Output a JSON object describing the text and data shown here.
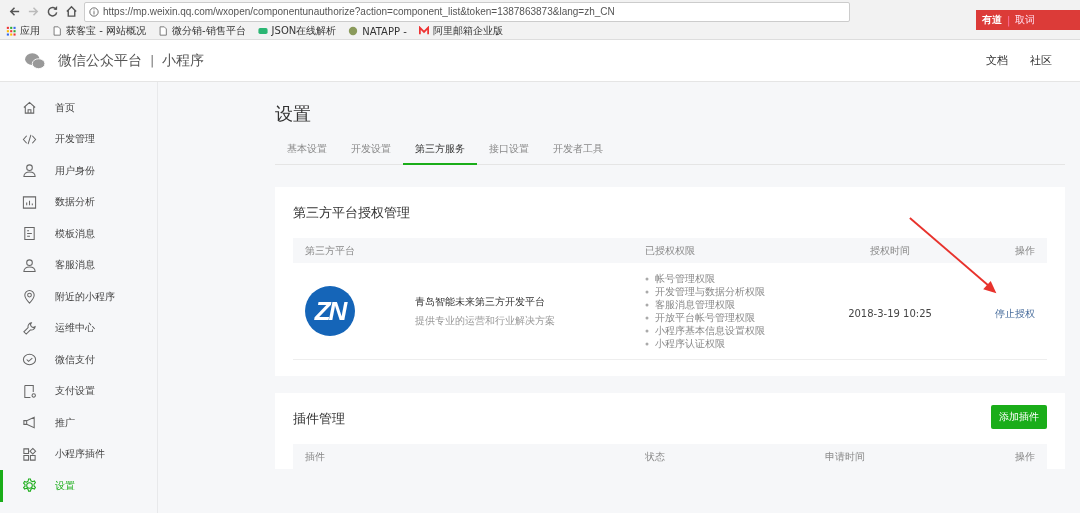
{
  "browser": {
    "url": "https://mp.weixin.qq.com/wxopen/componentunauthorize?action=component_list&token=1387863873&lang=zh_CN",
    "bookmarks": [
      {
        "kind": "apps",
        "label": "应用"
      },
      {
        "kind": "page",
        "label": "获客宝 - 网站概况"
      },
      {
        "kind": "page",
        "label": "微分销-销售平台"
      },
      {
        "kind": "json",
        "label": "JSON在线解析"
      },
      {
        "kind": "natapp",
        "label": "NATAPP -"
      },
      {
        "kind": "mail",
        "label": "阿里邮箱企业版"
      }
    ],
    "extension_popup": {
      "brand": "有道",
      "separator": "|",
      "action": "取词"
    }
  },
  "header": {
    "brand": "微信公众平台",
    "separator": "|",
    "product": "小程序",
    "links": [
      "文档",
      "社区"
    ]
  },
  "sidebar": {
    "items": [
      {
        "kind": "home",
        "label": "首页",
        "selected": false
      },
      {
        "kind": "code",
        "label": "开发管理",
        "selected": false
      },
      {
        "kind": "user",
        "label": "用户身份",
        "selected": false
      },
      {
        "kind": "chart",
        "label": "数据分析",
        "selected": false
      },
      {
        "kind": "doc",
        "label": "模板消息",
        "selected": false
      },
      {
        "kind": "user",
        "label": "客服消息",
        "selected": false
      },
      {
        "kind": "pin",
        "label": "附近的小程序",
        "selected": false
      },
      {
        "kind": "wrench",
        "label": "运维中心",
        "selected": false
      },
      {
        "kind": "pay",
        "label": "微信支付",
        "selected": false
      },
      {
        "kind": "payset",
        "label": "支付设置",
        "selected": false
      },
      {
        "kind": "megaphone",
        "label": "推广",
        "selected": false
      },
      {
        "kind": "plugin",
        "label": "小程序插件",
        "selected": false
      },
      {
        "kind": "gear",
        "label": "设置",
        "selected": true
      }
    ]
  },
  "page_title": "设置",
  "tabs": [
    {
      "label": "基本设置",
      "selected": false
    },
    {
      "label": "开发设置",
      "selected": false
    },
    {
      "label": "第三方服务",
      "selected": true
    },
    {
      "label": "接口设置",
      "selected": false
    },
    {
      "label": "开发者工具",
      "selected": false
    }
  ],
  "authorization": {
    "title": "第三方平台授权管理",
    "columns": [
      "第三方平台",
      "已授权权限",
      "授权时间",
      "操作"
    ],
    "rows": [
      {
        "logo_text": "ZN",
        "name": "青岛智能未来第三方开发平台",
        "description": "提供专业的运营和行业解决方案",
        "permissions": [
          "帐号管理权限",
          "开发管理与数据分析权限",
          "客服消息管理权限",
          "开放平台帐号管理权限",
          "小程序基本信息设置权限",
          "小程序认证权限"
        ],
        "time": "2018-3-19 10:25",
        "action": "停止授权"
      }
    ]
  },
  "plugins": {
    "title": "插件管理",
    "button": "添加插件",
    "columns": [
      "插件",
      "状态",
      "申请时间",
      "操作"
    ]
  }
}
